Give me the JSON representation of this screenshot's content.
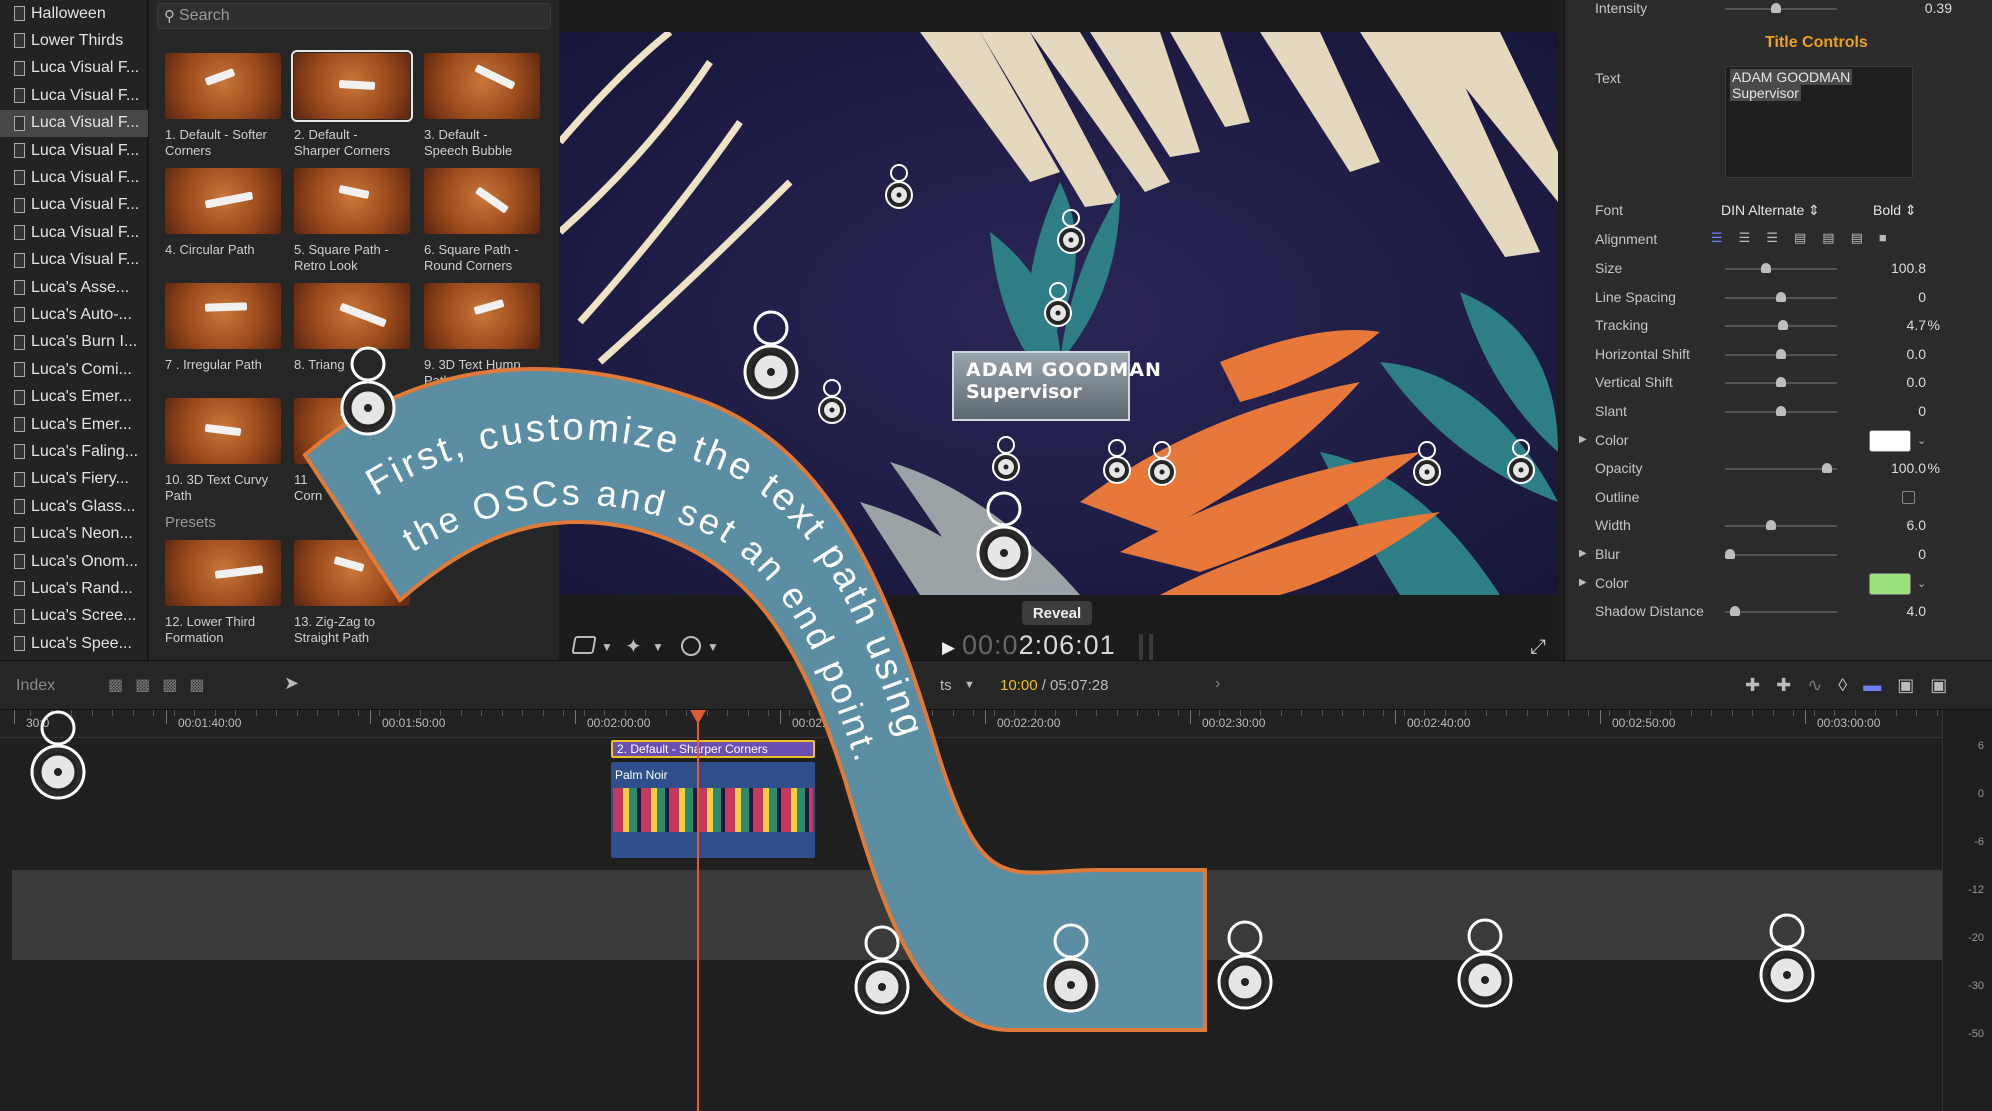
{
  "sidebar": {
    "items": [
      "Halloween",
      "Lower Thirds",
      "Luca Visual F...",
      "Luca Visual F...",
      "Luca Visual F...",
      "Luca Visual F...",
      "Luca Visual F...",
      "Luca Visual F...",
      "Luca Visual F...",
      "Luca Visual F...",
      "Luca's Asse...",
      "Luca's Auto-...",
      "Luca's Burn I...",
      "Luca's Comi...",
      "Luca's Emer...",
      "Luca's Emer...",
      "Luca's Faling...",
      "Luca's Fiery...",
      "Luca's Glass...",
      "Luca's Neon...",
      "Luca's Onom...",
      "Luca's Rand...",
      "Luca's Scree...",
      "Luca's Spee..."
    ],
    "selected_index": 4
  },
  "browser": {
    "search_placeholder": "Search",
    "presets_heading": "Presets",
    "thumbs": [
      {
        "l1": "1. Default - Softer",
        "l2": "Corners"
      },
      {
        "l1": "2. Default -",
        "l2": "Sharper Corners"
      },
      {
        "l1": "3. Default -",
        "l2": "Speech Bubble"
      },
      {
        "l1": "4. Circular Path",
        "l2": ""
      },
      {
        "l1": "5. Square Path  -",
        "l2": "Retro Look"
      },
      {
        "l1": "6. Square Path -",
        "l2": "Round Corners"
      },
      {
        "l1": "7 . Irregular Path",
        "l2": ""
      },
      {
        "l1": "8. Triang",
        "l2": ""
      },
      {
        "l1": "9. 3D Text Hump",
        "l2": "Path"
      },
      {
        "l1": "10. 3D Text Curvy",
        "l2": "Path"
      },
      {
        "l1": "11",
        "l2": "Corn"
      },
      {
        "l1": "12. Lower Third",
        "l2": "Formation"
      },
      {
        "l1": "13. Zig-Zag to",
        "l2": "Straight Path"
      }
    ]
  },
  "viewer": {
    "lower_third": {
      "name": "ADAM GOODMAN",
      "title": "Supervisor"
    },
    "reveal_label": "Reveal",
    "timecode_dim": "00:0",
    "timecode": "2:06:01"
  },
  "inspector": {
    "intensity_label": "Intensity",
    "intensity_value": "0.39",
    "section": "Title Controls",
    "text_label": "Text",
    "text_line1": "ADAM GOODMAN",
    "text_line2": "Supervisor",
    "font_label": "Font",
    "font_value": "DIN Alternate",
    "weight_value": "Bold",
    "alignment_label": "Alignment",
    "rows": [
      {
        "label": "Size",
        "value": "100.8",
        "pos": 0.35
      },
      {
        "label": "Line Spacing",
        "value": "0",
        "pos": 0.5
      },
      {
        "label": "Tracking",
        "value": "4.7",
        "unit": "%",
        "pos": 0.52
      },
      {
        "label": "Horizontal Shift",
        "value": "0.0",
        "pos": 0.5
      },
      {
        "label": "Vertical Shift",
        "value": "0.0",
        "pos": 0.5
      },
      {
        "label": "Slant",
        "value": "0",
        "pos": 0.5
      },
      {
        "label": "Color",
        "value": "",
        "pos": null
      },
      {
        "label": "Opacity",
        "value": "100.0",
        "unit": "%",
        "pos": 0.95
      },
      {
        "label": "Outline",
        "value": "",
        "pos": null
      },
      {
        "label": "Width",
        "value": "6.0",
        "pos": 0.4
      },
      {
        "label": "Blur",
        "value": "0",
        "pos": 0.0
      },
      {
        "label": "Color",
        "value": "",
        "pos": null
      },
      {
        "label": "Shadow Distance",
        "value": "4.0",
        "pos": 0.05
      }
    ],
    "color1": "#ffffff",
    "color2": "#9be07a"
  },
  "timeline": {
    "index_label": "Index",
    "ts_fragment": "ts",
    "time_current": "10:00",
    "time_total": "/ 05:07:28",
    "ruler": [
      "30:0",
      "00:01:40:00",
      "00:01:50:00",
      "00:02:00:00",
      "00:02:10:00",
      "00:02:20:00",
      "00:02:30:00",
      "00:02:40:00",
      "00:02:50:00",
      "00:03:00:00"
    ],
    "title_clip": "2. Default - Sharper Corners",
    "video_clip": "Palm Noir",
    "meter_labels": [
      "6",
      "0",
      "-6",
      "-12",
      "-20",
      "-30",
      "-50"
    ]
  },
  "overlay": {
    "line1": "First, customize the text path using",
    "line2": "the OSCs and set an end point."
  },
  "colors": {
    "accent": "#f0a020",
    "ribbon": "#5b8ea3",
    "ribbon_edge": "#e07a38",
    "playhead": "#e05a3a",
    "clip_title": "#5a3fa3"
  }
}
